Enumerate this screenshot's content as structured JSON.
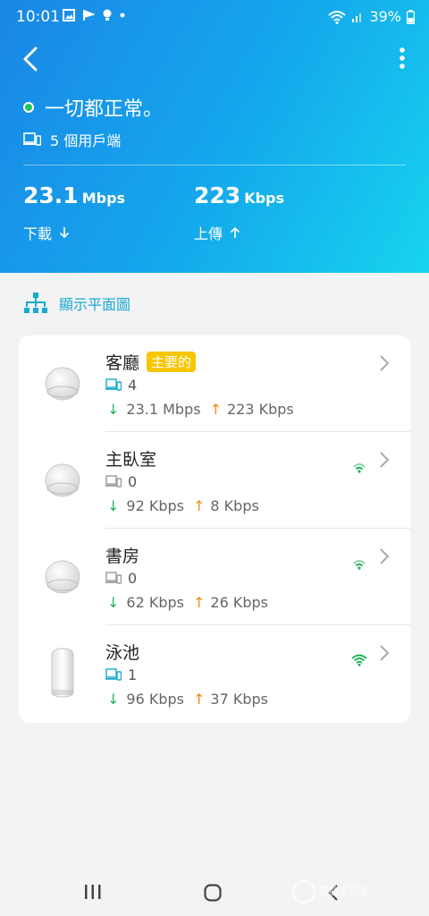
{
  "status_bar": {
    "time": "10:01",
    "battery": "39%"
  },
  "header": {
    "status_text": "一切都正常。",
    "clients_text": "5 個用戶端",
    "download": {
      "value": "23.1",
      "unit": "Mbps",
      "label": "下載"
    },
    "upload": {
      "value": "223",
      "unit": "Kbps",
      "label": "上傳"
    }
  },
  "floor_plan_link": "顯示平面圖",
  "devices": [
    {
      "name": "客廳",
      "badge": "主要的",
      "clients": "4",
      "down": "23.1 Mbps",
      "up": "223 Kbps"
    },
    {
      "name": "主臥室",
      "clients": "0",
      "down": "92 Kbps",
      "up": "8 Kbps"
    },
    {
      "name": "書房",
      "clients": "0",
      "down": "62 Kbps",
      "up": "26 Kbps"
    },
    {
      "name": "泳池",
      "clients": "1",
      "down": "96 Kbps",
      "up": "37 Kbps"
    }
  ],
  "watermark": "電腦王阿達",
  "colors": {
    "header_start": "#1a86e6",
    "header_end": "#17d4ee",
    "status_ok": "#22c55e",
    "link": "#1aa9cf",
    "badge": "#f7c600",
    "down_arrow": "#22b35a",
    "up_arrow": "#f08a14",
    "wifi": "#22b35a"
  },
  "icons": [
    "back-icon",
    "more-icon",
    "client-device-icon",
    "topology-icon",
    "wifi-signal-icon",
    "chevron-right-icon"
  ]
}
